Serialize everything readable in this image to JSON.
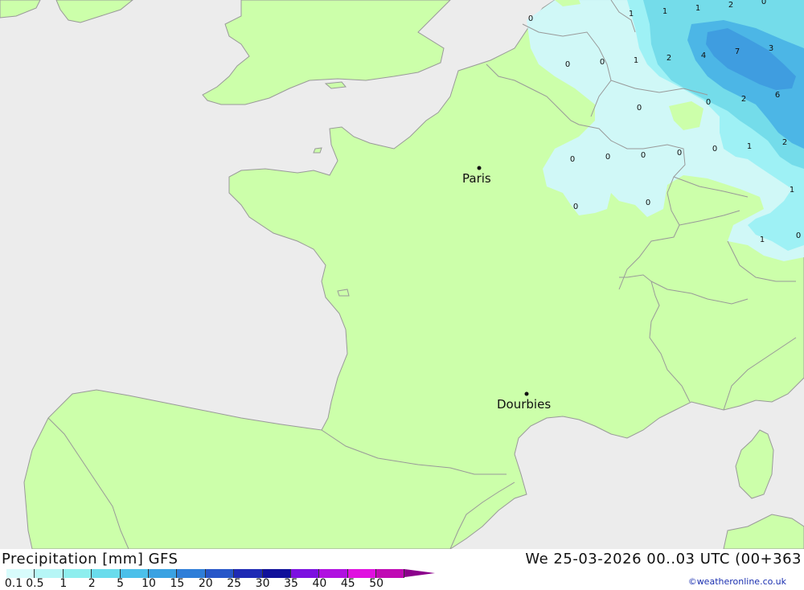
{
  "title": "Precipitation [mm] GFS",
  "datetime": "We 25-03-2026 00..03 UTC (00+363",
  "credit": "©weatheronline.co.uk",
  "colors": {
    "sea": "#ececec",
    "land": "#ccffaa",
    "border": "#999999",
    "precip_light": "#d0f8fb",
    "precip_mid": "#9ef1f5",
    "precip_high": "#74dcea",
    "precip_heavy": "#4cb6e6",
    "precip_max": "#3f9de0"
  },
  "legend": {
    "labels": [
      "0.1",
      "0.5",
      "1",
      "2",
      "5",
      "10",
      "15",
      "20",
      "25",
      "30",
      "35",
      "40",
      "45",
      "50"
    ],
    "colors": [
      "#d8fcfc",
      "#b6f6f6",
      "#8eeeee",
      "#6adcec",
      "#4cc0ea",
      "#3aa2e2",
      "#2e7ed8",
      "#2656c8",
      "#1e2ab4",
      "#10109a",
      "#7c10e0",
      "#b010e0",
      "#e010e0",
      "#c00ab4"
    ]
  },
  "cities": [
    {
      "name": "Paris"
    },
    {
      "name": "Dourbies"
    }
  ],
  "precip_values": [
    "0",
    "1",
    "1",
    "2",
    "1",
    "0",
    "0",
    "0",
    "1",
    "2",
    "4",
    "7",
    "3",
    "0",
    "0",
    "2",
    "6",
    "0",
    "0",
    "0",
    "0",
    "0",
    "1",
    "2",
    "1",
    "0",
    "0",
    "1",
    "0"
  ]
}
